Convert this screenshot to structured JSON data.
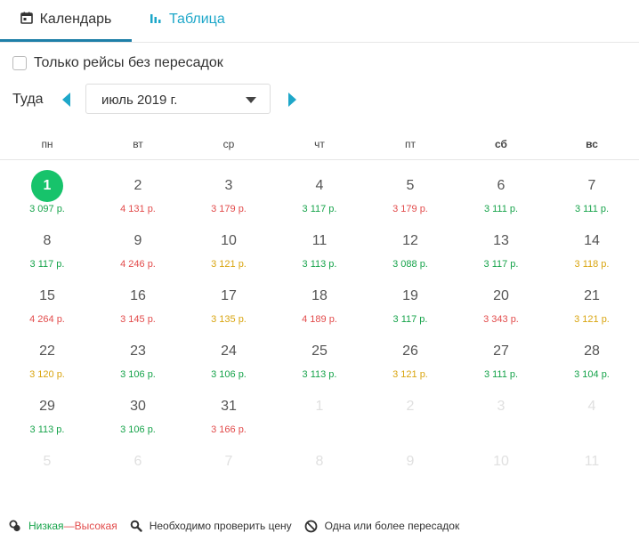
{
  "tabs": [
    {
      "label": "Календарь",
      "icon": "calendar-icon",
      "active": true
    },
    {
      "label": "Таблица",
      "icon": "bar-chart-icon",
      "active": false
    }
  ],
  "filter": {
    "nonstop_label": "Только рейсы без пересадок",
    "checked": false
  },
  "month_nav": {
    "direction_label": "Туда",
    "month_value": "июль 2019 г."
  },
  "weekdays": [
    "пн",
    "вт",
    "ср",
    "чт",
    "пт",
    "сб",
    "вс"
  ],
  "weeks": [
    [
      {
        "day": "1",
        "price": "3 097 р.",
        "level": "green",
        "selected": true
      },
      {
        "day": "2",
        "price": "4 131 р.",
        "level": "red"
      },
      {
        "day": "3",
        "price": "3 179 р.",
        "level": "red"
      },
      {
        "day": "4",
        "price": "3 117 р.",
        "level": "green"
      },
      {
        "day": "5",
        "price": "3 179 р.",
        "level": "red"
      },
      {
        "day": "6",
        "price": "3 111 р.",
        "level": "green"
      },
      {
        "day": "7",
        "price": "3 111 р.",
        "level": "green"
      }
    ],
    [
      {
        "day": "8",
        "price": "3 117 р.",
        "level": "green"
      },
      {
        "day": "9",
        "price": "4 246 р.",
        "level": "red"
      },
      {
        "day": "10",
        "price": "3 121 р.",
        "level": "yellow"
      },
      {
        "day": "11",
        "price": "3 113 р.",
        "level": "green"
      },
      {
        "day": "12",
        "price": "3 088 р.",
        "level": "green"
      },
      {
        "day": "13",
        "price": "3 117 р.",
        "level": "green"
      },
      {
        "day": "14",
        "price": "3 118 р.",
        "level": "yellow"
      }
    ],
    [
      {
        "day": "15",
        "price": "4 264 р.",
        "level": "red"
      },
      {
        "day": "16",
        "price": "3 145 р.",
        "level": "red"
      },
      {
        "day": "17",
        "price": "3 135 р.",
        "level": "yellow"
      },
      {
        "day": "18",
        "price": "4 189 р.",
        "level": "red"
      },
      {
        "day": "19",
        "price": "3 117 р.",
        "level": "green"
      },
      {
        "day": "20",
        "price": "3 343 р.",
        "level": "red"
      },
      {
        "day": "21",
        "price": "3 121 р.",
        "level": "yellow"
      }
    ],
    [
      {
        "day": "22",
        "price": "3 120 р.",
        "level": "yellow"
      },
      {
        "day": "23",
        "price": "3 106 р.",
        "level": "green"
      },
      {
        "day": "24",
        "price": "3 106 р.",
        "level": "green"
      },
      {
        "day": "25",
        "price": "3 113 р.",
        "level": "green"
      },
      {
        "day": "26",
        "price": "3 121 р.",
        "level": "yellow"
      },
      {
        "day": "27",
        "price": "3 111 р.",
        "level": "green"
      },
      {
        "day": "28",
        "price": "3 104 р.",
        "level": "green"
      }
    ],
    [
      {
        "day": "29",
        "price": "3 113 р.",
        "level": "green"
      },
      {
        "day": "30",
        "price": "3 106 р.",
        "level": "green"
      },
      {
        "day": "31",
        "price": "3 166 р.",
        "level": "red"
      },
      {
        "day": "1",
        "muted": true
      },
      {
        "day": "2",
        "muted": true
      },
      {
        "day": "3",
        "muted": true
      },
      {
        "day": "4",
        "muted": true
      }
    ],
    [
      {
        "day": "5",
        "muted": true
      },
      {
        "day": "6",
        "muted": true
      },
      {
        "day": "7",
        "muted": true
      },
      {
        "day": "8",
        "muted": true
      },
      {
        "day": "9",
        "muted": true
      },
      {
        "day": "10",
        "muted": true
      },
      {
        "day": "11",
        "muted": true
      }
    ]
  ],
  "legend": {
    "low_label": "Низкая",
    "separator": "—",
    "high_label": "Высокая",
    "check_price_label": "Необходимо проверить цену",
    "stops_label": "Одна или более пересадок"
  },
  "colors": {
    "accent": "#1ea7c9",
    "low": "#16a34a",
    "mid": "#d9a510",
    "high": "#e24b4b",
    "selected": "#17c36b"
  }
}
